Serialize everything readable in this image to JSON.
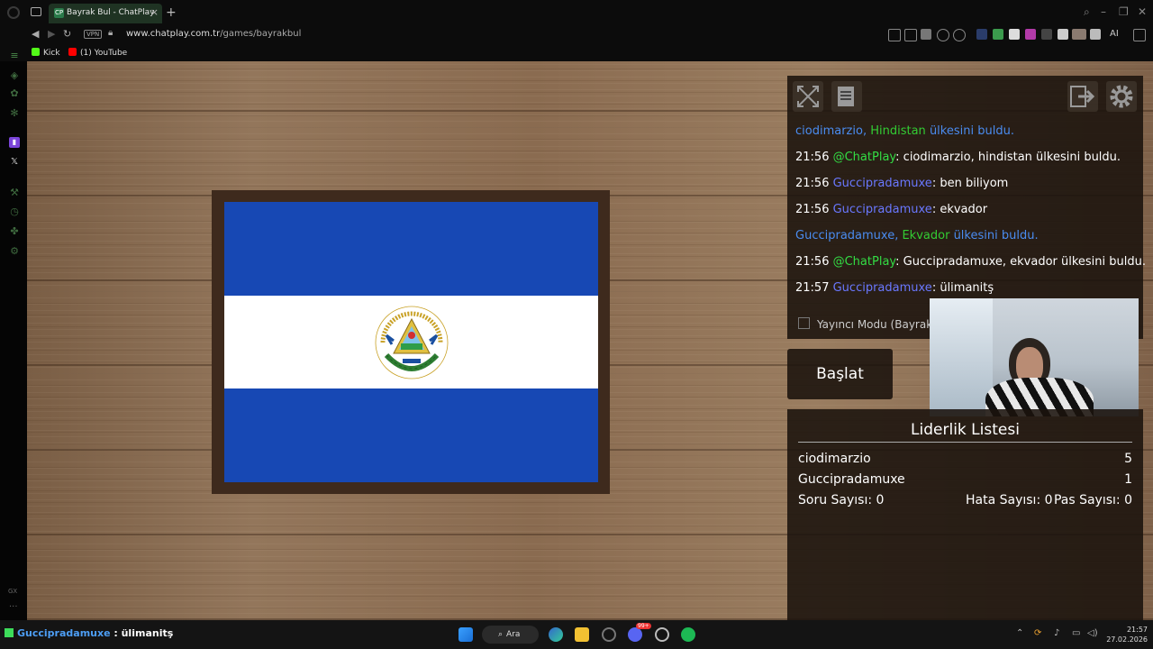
{
  "browser": {
    "tab_title": "Bayrak Bul - ChatPlay",
    "tab_favicon_text": "CP",
    "new_tab": "+",
    "vpn_label": "VPN",
    "url_domain": "www.chatplay.com.tr",
    "url_path": "/games/bayrakbul",
    "ai_label": "AI",
    "bookmarks": [
      {
        "label": "Kick",
        "color": "#53fc18"
      },
      {
        "label": "(1) YouTube",
        "color": "#ff0000"
      }
    ]
  },
  "sidebar": {
    "gx_label": "GX",
    "more_label": "···",
    "icons": [
      "feed-icon",
      "music-icon",
      "bug-icon",
      "tree-icon",
      "twitch-icon",
      "x-icon",
      "tool-icon",
      "clock-icon",
      "puzzle-icon",
      "settings-icon"
    ]
  },
  "game": {
    "flag_country": "El Salvador",
    "flag_colors": {
      "blue": "#1748b4",
      "white": "#ffffff"
    },
    "coat_text_top": "REPUBLICA DE EL SALVADOR EN LA AMERICA CENTRAL",
    "chat": [
      {
        "type": "system",
        "user": "ciodimarzio,",
        "country": "Hindistan",
        "text": "ülkesini buldu."
      },
      {
        "type": "msg",
        "time": "21:56",
        "user": "@ChatPlay",
        "bot": true,
        "text": ": ciodimarzio, hindistan ülkesini buldu."
      },
      {
        "type": "msg",
        "time": "21:56",
        "user": "Guccipradamuxe",
        "bot": false,
        "text": ": ben biliyom"
      },
      {
        "type": "msg",
        "time": "21:56",
        "user": "Guccipradamuxe",
        "bot": false,
        "text": ": ekvador"
      },
      {
        "type": "system",
        "user": "Guccipradamuxe,",
        "country": "Ekvador",
        "text": "ülkesini buldu."
      },
      {
        "type": "msg",
        "time": "21:56",
        "user": "@ChatPlay",
        "bot": true,
        "text": ": Guccipradamuxe, ekvador ülkesini buldu."
      },
      {
        "type": "msg",
        "time": "21:57",
        "user": "Guccipradamuxe",
        "bot": false,
        "text": ": ülimanitş"
      }
    ],
    "streamer_mode_label": "Yayıncı Modu (Bayrak |",
    "start_button": "Başlat",
    "leaderboard": {
      "title": "Liderlik Listesi",
      "rows": [
        {
          "name": "ciodimarzio",
          "score": "5"
        },
        {
          "name": "Guccipradamuxe",
          "score": "1"
        }
      ],
      "stats": {
        "questions": "Soru Sayısı: 0",
        "errors": "Hata Sayısı: 0",
        "passes": "Pas Sayısı: 0"
      }
    }
  },
  "taskbar": {
    "chat_user": "Guccipradamuxe",
    "chat_message": " : ülimanitş",
    "search_label": "Ara",
    "time": "21:57",
    "date": "27.02.2026",
    "discord_badge": "99+"
  }
}
